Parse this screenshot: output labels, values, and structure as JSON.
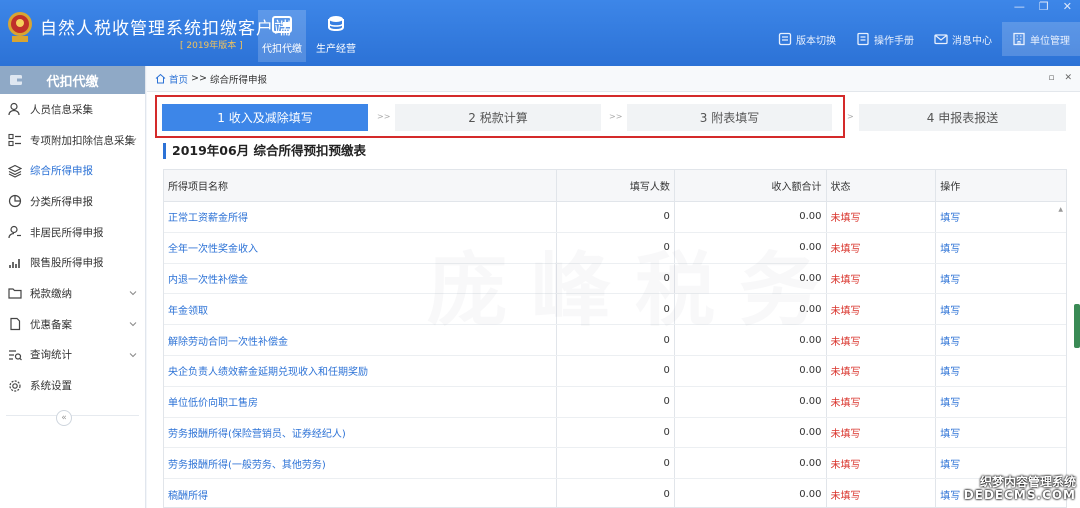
{
  "header": {
    "app_title": "自然人税收管理系统扣缴客户端",
    "edition": "[ 2019年版本 ]",
    "tabs": [
      {
        "label": "代扣代缴",
        "icon": "wallet-icon"
      },
      {
        "label": "生产经营",
        "icon": "coins-icon"
      }
    ],
    "tools": [
      {
        "label": "版本切换",
        "icon": "version-icon"
      },
      {
        "label": "操作手册",
        "icon": "manual-icon"
      },
      {
        "label": "消息中心",
        "icon": "mail-icon"
      },
      {
        "label": "单位管理",
        "icon": "building-icon"
      }
    ],
    "window_controls": [
      "—",
      "❐",
      "✕"
    ]
  },
  "sidebar": {
    "header": "代扣代缴",
    "items": [
      {
        "label": "人员信息采集",
        "icon": "person-icon",
        "expandable": false
      },
      {
        "label": "专项附加扣除信息采集",
        "icon": "list-icon",
        "expandable": true
      },
      {
        "label": "综合所得申报",
        "icon": "layers-icon",
        "expandable": false
      },
      {
        "label": "分类所得申报",
        "icon": "pie-icon",
        "expandable": false
      },
      {
        "label": "非居民所得申报",
        "icon": "person-outline-icon",
        "expandable": false
      },
      {
        "label": "限售股所得申报",
        "icon": "bar-chart-icon",
        "expandable": false
      },
      {
        "label": "税款缴纳",
        "icon": "folder-icon",
        "expandable": true
      },
      {
        "label": "优惠备案",
        "icon": "document-icon",
        "expandable": true
      },
      {
        "label": "查询统计",
        "icon": "query-icon",
        "expandable": true
      },
      {
        "label": "系统设置",
        "icon": "gear-icon",
        "expandable": false
      }
    ],
    "collapse": "«"
  },
  "breadcrumb": {
    "home": "首页",
    "sep": ">>",
    "current": "综合所得申报",
    "controls": [
      "▫",
      "✕"
    ]
  },
  "steps": [
    {
      "label": "1 收入及减除填写"
    },
    {
      "label": "2 税款计算"
    },
    {
      "label": "3 附表填写"
    },
    {
      "label": "4 申报表报送"
    }
  ],
  "step_arrows": [
    ">>",
    ">>",
    ">"
  ],
  "form_title": "2019年06月  综合所得预扣预缴表",
  "table": {
    "columns": [
      "所得项目名称",
      "填写人数",
      "收入额合计",
      "状态",
      "操作"
    ],
    "rows": [
      {
        "name": "正常工资薪金所得",
        "count": "0",
        "income": "0.00",
        "status": "未填写",
        "action": "填写"
      },
      {
        "name": "全年一次性奖金收入",
        "count": "0",
        "income": "0.00",
        "status": "未填写",
        "action": "填写"
      },
      {
        "name": "内退一次性补偿金",
        "count": "0",
        "income": "0.00",
        "status": "未填写",
        "action": "填写"
      },
      {
        "name": "年金领取",
        "count": "0",
        "income": "0.00",
        "status": "未填写",
        "action": "填写"
      },
      {
        "name": "解除劳动合同一次性补偿金",
        "count": "0",
        "income": "0.00",
        "status": "未填写",
        "action": "填写"
      },
      {
        "name": "央企负责人绩效薪金延期兑现收入和任期奖励",
        "count": "0",
        "income": "0.00",
        "status": "未填写",
        "action": "填写"
      },
      {
        "name": "单位低价向职工售房",
        "count": "0",
        "income": "0.00",
        "status": "未填写",
        "action": "填写"
      },
      {
        "name": "劳务报酬所得(保险营销员、证券经纪人)",
        "count": "0",
        "income": "0.00",
        "status": "未填写",
        "action": "填写"
      },
      {
        "name": "劳务报酬所得(一般劳务、其他劳务)",
        "count": "0",
        "income": "0.00",
        "status": "未填写",
        "action": "填写"
      },
      {
        "name": "稿酬所得",
        "count": "0",
        "income": "0.00",
        "status": "未填写",
        "action": "填写"
      }
    ]
  },
  "watermark": {
    "center": "庞峰税务",
    "corner_line1": "织梦内容管理系统",
    "corner_line2": "DEDECMS.COM"
  },
  "colors": {
    "primary": "#3d86e8",
    "status_red": "#d9332b",
    "highlight_box": "#d42a2a",
    "sidebar_header": "#8fa9c6"
  }
}
